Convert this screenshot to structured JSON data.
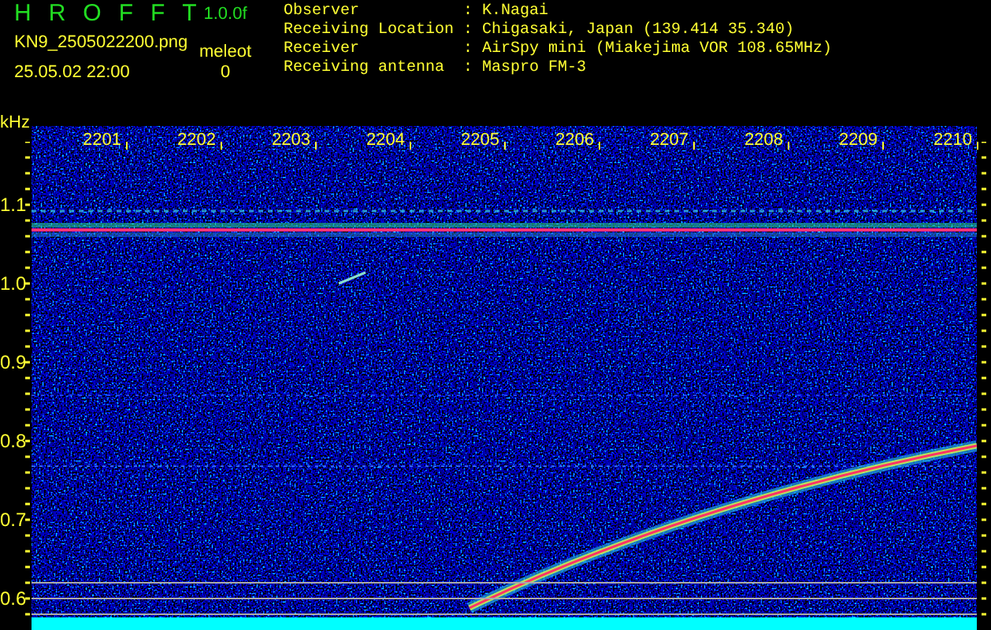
{
  "header": {
    "app_title": "HROFFT",
    "version": "1.0.0f",
    "file_name": "KN9_2505022200.png",
    "date_time": "25.05.02 22:00",
    "meteor_label": "meleot",
    "meteor_count": "0"
  },
  "info": [
    {
      "label": "Observer",
      "separator": ":",
      "value": "K.Nagai"
    },
    {
      "label": "Receiving Location",
      "separator": ":",
      "value": "Chigasaki, Japan (139.414 35.340)"
    },
    {
      "label": "Receiver",
      "separator": ":",
      "value": "AirSpy mini (Miakejima VOR 108.65MHz)"
    },
    {
      "label": "Receiving antenna",
      "separator": ":",
      "value": "Maspro FM-3"
    }
  ],
  "spectrogram": {
    "y_unit": "kHz",
    "x_labels": [
      "2201",
      "2202",
      "2203",
      "2204",
      "2205",
      "2206",
      "2207",
      "2208",
      "2209",
      "2210"
    ],
    "y_labels": [
      "1.1",
      "1.0",
      "0.9",
      "0.8",
      "0.7",
      "0.6"
    ]
  }
}
